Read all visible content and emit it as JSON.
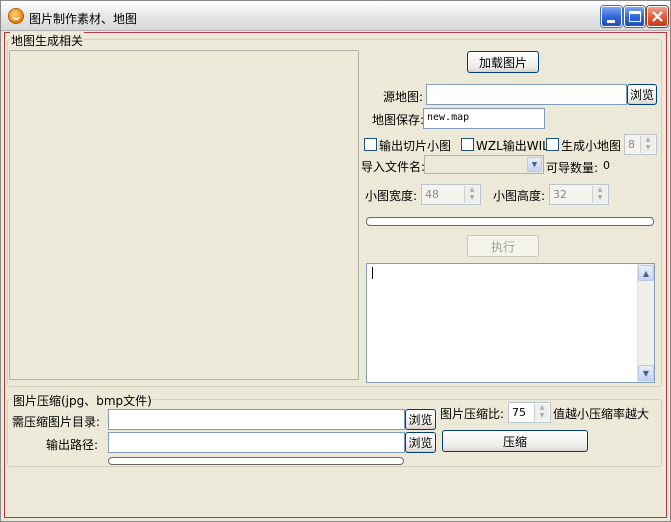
{
  "window": {
    "title": "图片制作素材、地图",
    "icon": "app-logo-icon",
    "controls": {
      "minimize": "minimize-icon",
      "maximize": "maximize-icon",
      "close": "close-icon"
    }
  },
  "map_group": {
    "title": "地图生成相关",
    "load_button": "加载图片",
    "source_map_label": "源地图:",
    "source_map_value": "",
    "browse_label": "浏览",
    "map_save_label": "地图保存:",
    "map_save_value": "new.map",
    "export_tiles_label": "输出切片小图",
    "export_wzl_label": "WZL输出WIL",
    "gen_minimap_label": "生成小地图",
    "minimap_value": "8",
    "import_file_label": "导入文件名:",
    "import_file_value": "",
    "importable_count_label": "可导数量:",
    "importable_count_value": "0",
    "minimap_width_label": "小图宽度:",
    "minimap_width_value": "48",
    "minimap_height_label": "小图高度:",
    "minimap_height_value": "32",
    "progress": 0,
    "execute_button": "执行",
    "log_text": ""
  },
  "compress_group": {
    "title": "图片压缩(jpg、bmp文件)",
    "source_dir_label": "需压缩图片目录:",
    "source_dir_value": "",
    "browse_label": "浏览",
    "ratio_label": "图片压缩比:",
    "ratio_value": "75",
    "ratio_hint": "值越小压缩率越大",
    "output_path_label": "输出路径:",
    "output_path_value": "",
    "browse2_label": "浏览",
    "compress_button": "压缩",
    "progress": 0
  },
  "colors": {
    "window_bg": "#ece9d8",
    "frame_accent": "#b03a4a",
    "input_border": "#7f9db9"
  }
}
